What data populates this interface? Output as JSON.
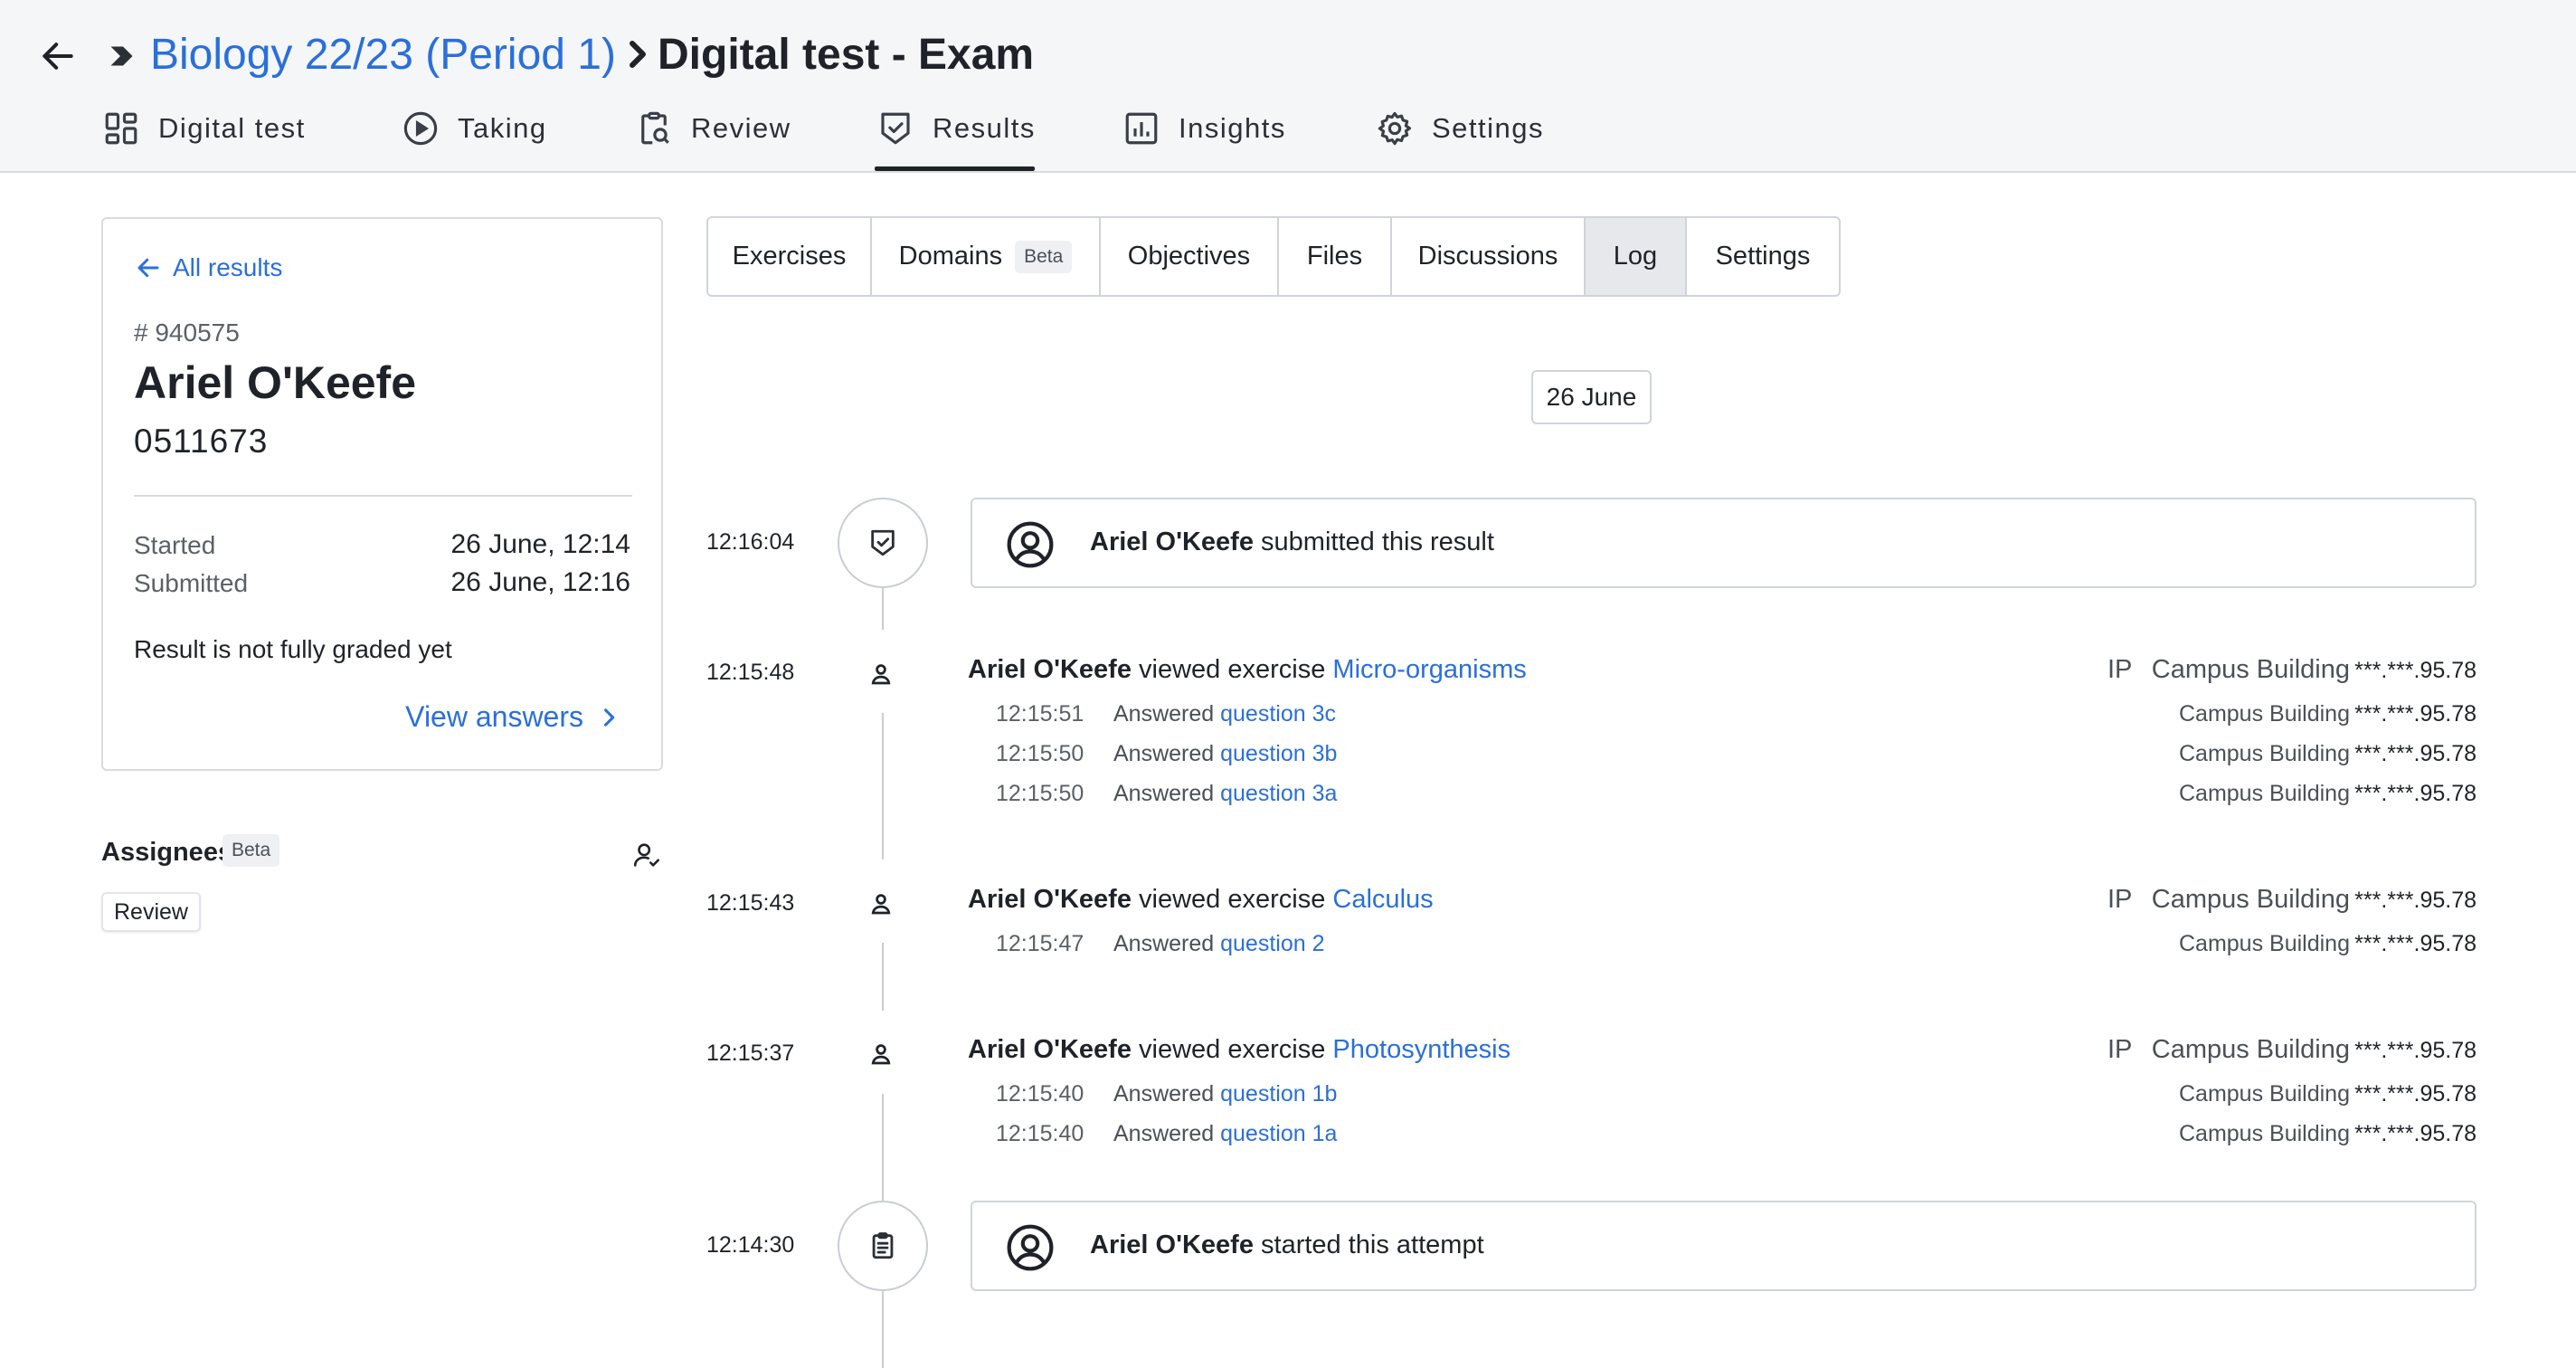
{
  "header": {
    "breadcrumb_course": "Biology 22/23 (Period 1)",
    "breadcrumb_separator": ">",
    "title": "Digital test - Exam",
    "tabs": [
      {
        "label": "Digital test",
        "icon": "dashboard-icon"
      },
      {
        "label": "Taking",
        "icon": "play-circle-icon"
      },
      {
        "label": "Review",
        "icon": "clipboard-search-icon"
      },
      {
        "label": "Results",
        "icon": "shield-check-icon",
        "active": true
      },
      {
        "label": "Insights",
        "icon": "bar-chart-icon"
      },
      {
        "label": "Settings",
        "icon": "gear-icon"
      }
    ]
  },
  "sidebar": {
    "back_link": "All results",
    "result_id": "# 940575",
    "student_name": "Ariel O'Keefe",
    "student_number": "0511673",
    "started_label": "Started",
    "started_value": "26 June, 12:14",
    "submitted_label": "Submitted",
    "submitted_value": "26 June, 12:16",
    "grade_status": "Result is not fully graded yet",
    "view_answers": "View answers",
    "assignees_title": "Assignees",
    "assignees_badge": "Beta",
    "review_chip": "Review"
  },
  "subtabs": [
    {
      "label": "Exercises"
    },
    {
      "label": "Domains",
      "badge": "Beta"
    },
    {
      "label": "Objectives"
    },
    {
      "label": "Files"
    },
    {
      "label": "Discussions"
    },
    {
      "label": "Log",
      "active": true
    },
    {
      "label": "Settings"
    }
  ],
  "log": {
    "date": "26 June",
    "ip_label": "IP",
    "events": [
      {
        "time": "12:16:04",
        "actor": "Ariel O'Keefe",
        "text": "submitted this result",
        "icon": "shield-check-icon"
      },
      {
        "time": "12:15:48",
        "actor": "Ariel O'Keefe",
        "action": "viewed exercise",
        "exercise": "Micro-organisms",
        "location": "Campus Building",
        "ip": "***.***.95.78",
        "answers": [
          {
            "time": "12:15:51",
            "action": "Answered",
            "question": "question 3c",
            "location": "Campus Building",
            "ip": "***.***.95.78"
          },
          {
            "time": "12:15:50",
            "action": "Answered",
            "question": "question 3b",
            "location": "Campus Building",
            "ip": "***.***.95.78"
          },
          {
            "time": "12:15:50",
            "action": "Answered",
            "question": "question 3a",
            "location": "Campus Building",
            "ip": "***.***.95.78"
          }
        ]
      },
      {
        "time": "12:15:43",
        "actor": "Ariel O'Keefe",
        "action": "viewed exercise",
        "exercise": "Calculus",
        "location": "Campus Building",
        "ip": "***.***.95.78",
        "answers": [
          {
            "time": "12:15:47",
            "action": "Answered",
            "question": "question 2",
            "location": "Campus Building",
            "ip": "***.***.95.78"
          }
        ]
      },
      {
        "time": "12:15:37",
        "actor": "Ariel O'Keefe",
        "action": "viewed exercise",
        "exercise": "Photosynthesis",
        "location": "Campus Building",
        "ip": "***.***.95.78",
        "answers": [
          {
            "time": "12:15:40",
            "action": "Answered",
            "question": "question 1b",
            "location": "Campus Building",
            "ip": "***.***.95.78"
          },
          {
            "time": "12:15:40",
            "action": "Answered",
            "question": "question 1a",
            "location": "Campus Building",
            "ip": "***.***.95.78"
          }
        ]
      },
      {
        "time": "12:14:30",
        "actor": "Ariel O'Keefe",
        "text": "started this attempt",
        "icon": "clipboard-list-icon"
      }
    ]
  }
}
